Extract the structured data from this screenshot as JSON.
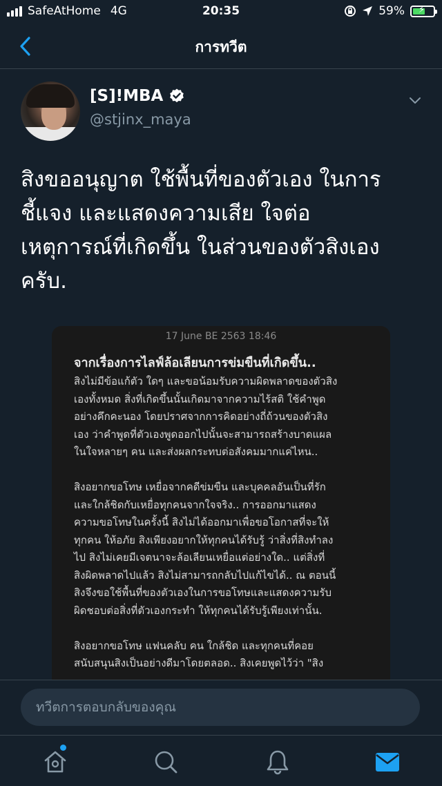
{
  "status_bar": {
    "carrier": "SafeAtHome",
    "network": "4G",
    "time": "20:35",
    "battery": "59%",
    "battery_level": 0.59,
    "battery_color": "#4cd964"
  },
  "nav": {
    "title": "การทวีต",
    "back_icon": "chevron-left-icon"
  },
  "tweet": {
    "display_name": "[S]!MBA",
    "verified": true,
    "handle": "@stjinx_maya",
    "text": "สิงขออนุญาต ใช้พื้นที่ของตัวเอง ในการ\nชี้แจง และแสดงความเสีย ใจต่อ\nเหตุการณ์ที่เกิดขึ้น ในส่วนของตัวสิงเอง\nครับ."
  },
  "media": {
    "date": "17 June BE 2563 18:46",
    "title": "จากเรื่องการไลฟ์ล้อเลียนการข่มขืนที่เกิดขึ้น..",
    "body": "สิงไม่มีข้อแก้ตัว ใดๆ และขอน้อมรับความผิดพลาดของตัวสิง\nเองทั้งหมด สิ่งที่เกิดขึ้นนั้นเกิดมาจากความไร้สติ ใช้คำพูด\nอย่างคึกคะนอง โดยปราศจากการคิดอย่างถี่ถ้วนของตัวสิง\nเอง ว่าคำพูดที่ตัวเองพูดออกไปนั้นจะสามารถสร้างบาดแผล\nในใจหลายๆ คน และส่งผลกระทบต่อสังคมมากแค่ไหน..\n\nสิงอยากขอโทษ เหยื่อจากคดีข่มขืน และบุคคลอันเป็นที่รัก\nและใกล้ชิดกับเหยื่อทุกคนจากใจจริง.. การออกมาแสดง\nความขอโทษในครั้งนี้ สิงไม่ได้ออกมาเพื่อขอโอกาสที่จะให้\nทุกคน ให้อภัย สิงเพียงอยากให้ทุกคนได้รับรู้ ว่าสิ่งที่สิงทำลง\nไป สิงไม่เคยมีเจตนาจะล้อเลียนเหยื่อแต่อย่างใด.. แต่สิ่งที่\nสิงผิดพลาดไปแล้ว สิงไม่สามารถกลับไปแก้ไขได้.. ณ ตอนนี้\nสิงจึงขอใช้พื้นที่ของตัวเองในการขอโทษและแสดงความรับ\nผิดชอบต่อสิ่งที่ตัวเองกระทำ ให้ทุกคนได้รับรู้เพียงเท่านั้น.\n\nสิงอยากขอโทษ แฟนคลับ คน ใกล้ชิด และทุกคนที่คอย\nสนับสนุนสิงเป็นอย่างดีมาโดยตลอด.. สิงเคยพูดไว้ว่า \"สิง"
  },
  "reply": {
    "placeholder": "ทวีตการตอบกลับของคุณ"
  },
  "tab_bar": {
    "items": [
      {
        "icon": "home-icon",
        "active": false,
        "notification_dot": true
      },
      {
        "icon": "search-icon",
        "active": false
      },
      {
        "icon": "bell-icon",
        "active": false
      },
      {
        "icon": "mail-icon",
        "active": true
      }
    ],
    "accent_color": "#1da1f2",
    "inactive_color": "#8899a6"
  },
  "colors": {
    "background": "#15202b",
    "secondary_text": "#8899a6",
    "border": "#38444d"
  }
}
